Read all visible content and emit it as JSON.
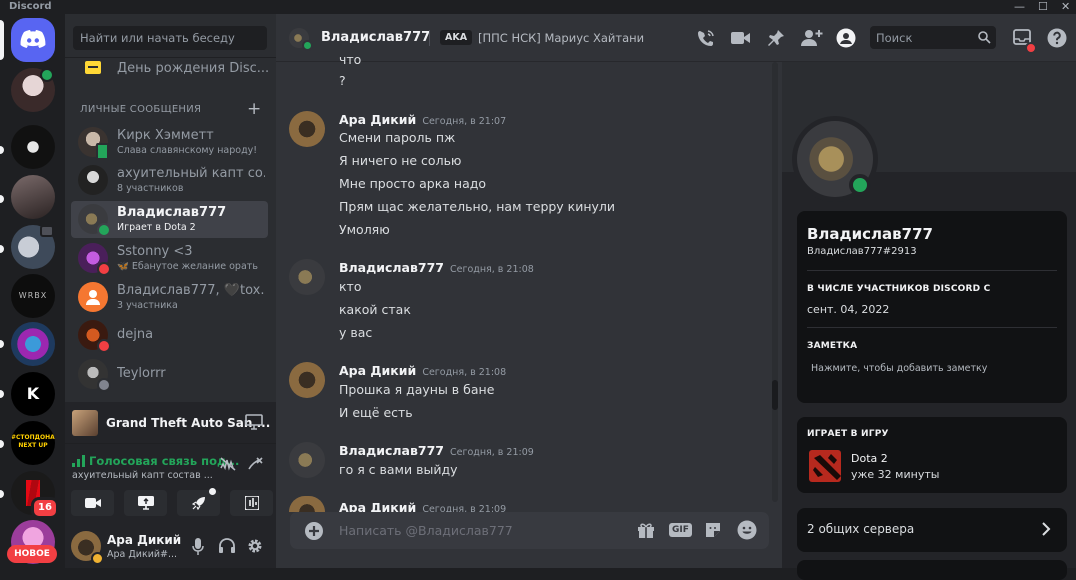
{
  "app": {
    "title": "Discord"
  },
  "window_controls": {
    "minimize": "—",
    "maximize": "☐",
    "close": "✕"
  },
  "servers": {
    "notification_count": "16",
    "new_label": "НОВОЕ",
    "server_text": [
      "WRBX",
      "K",
      "#СТОПДОНАТ NEXT UP"
    ]
  },
  "dm_sidebar": {
    "search_placeholder": "Найти или начать беседу",
    "birthday_label": "День рождения Disc...",
    "section_title": "ЛИЧНЫЕ СООБЩЕНИЯ",
    "add_label": "+",
    "items": [
      {
        "name": "Кирк Хэмметт",
        "sub": "Слава славянскому народу!"
      },
      {
        "name": "ахуительный капт со...",
        "sub": "8 участников"
      },
      {
        "name": "Владислав777",
        "sub": "Играет в Dota 2"
      },
      {
        "name": "Sstonny <3",
        "sub": "🦋 Ебанутое желание орать"
      },
      {
        "name": "Владислав777, 🖤tox...",
        "sub": "3 участника"
      },
      {
        "name": "dejna",
        "sub": ""
      },
      {
        "name": "Teylorrr",
        "sub": ""
      }
    ]
  },
  "activity": {
    "game": "Grand Theft Auto San ..."
  },
  "voice": {
    "status": "Голосовая связь под...",
    "channel": "ахуительный капт состав ..."
  },
  "user": {
    "name": "Ара Дикий",
    "tag": "Ара Дикий#..."
  },
  "header": {
    "channel_name": "Владислав777",
    "aka_label": "AKA",
    "aka_value": "[ППС НСК] Мариус Хайтани",
    "search_placeholder": "Поиск"
  },
  "messages": {
    "top_partial": [
      "что",
      "?"
    ],
    "groups": [
      {
        "author": "Ара Дикий",
        "time": "Сегодня, в 21:07",
        "lines": [
          "Смени пароль пж",
          "Я ничего не солью",
          "Мне просто арка надо",
          "Прям щас желательно, нам терру кинули",
          "Умоляю"
        ]
      },
      {
        "author": "Владислав777",
        "time": "Сегодня, в 21:08",
        "lines": [
          "кто",
          "какой стак",
          "у вас"
        ]
      },
      {
        "author": "Ара Дикий",
        "time": "Сегодня, в 21:08",
        "lines": [
          "Прошка я дауны в бане",
          "И ещё есть"
        ]
      },
      {
        "author": "Владислав777",
        "time": "Сегодня, в 21:09",
        "lines": [
          "го я с вами выйду"
        ]
      },
      {
        "author": "Ара Дикий",
        "time": "Сегодня, в 21:09",
        "lines": []
      }
    ]
  },
  "composer": {
    "placeholder": "Написать @Владислав777",
    "gif_label": "GIF"
  },
  "profile": {
    "display_name": "Владислав777",
    "tag": "Владислав777#2913",
    "member_since_title": "В ЧИСЛЕ УЧАСТНИКОВ DISCORD С",
    "member_since": "сент. 04, 2022",
    "note_title": "ЗАМЕТКА",
    "note_placeholder": "Нажмите, чтобы добавить заметку",
    "playing_title": "ИГРАЕТ В ИГРУ",
    "game_name": "Dota 2",
    "game_time": "уже 32 минуты",
    "mutual_servers": "2 общих сервера"
  },
  "colors": {
    "accent": "#5865f2",
    "online": "#23a55a",
    "dnd": "#f23f43",
    "background": "#313338"
  }
}
